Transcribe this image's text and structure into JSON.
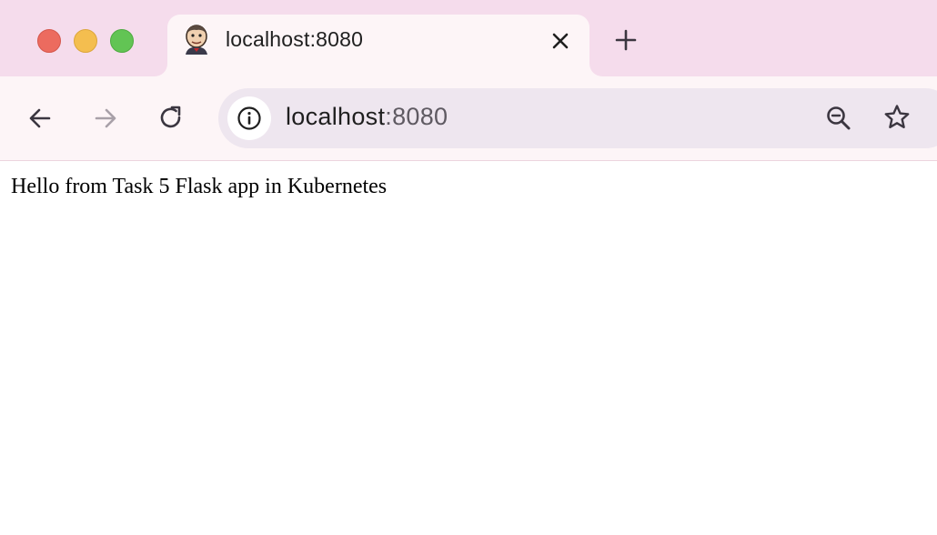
{
  "window": {
    "traffic_lights": [
      "close",
      "minimize",
      "maximize"
    ]
  },
  "tab": {
    "title": "localhost:8080",
    "favicon": "jenkins-butler-icon"
  },
  "toolbar": {
    "url_host": "localhost",
    "url_port": ":8080",
    "icons": [
      "back-arrow-icon",
      "forward-arrow-icon",
      "reload-icon",
      "site-info-icon",
      "zoom-out-icon",
      "bookmark-star-icon"
    ]
  },
  "page": {
    "text": "Hello from Task 5 Flask app in Kubernetes"
  },
  "colors": {
    "titlebar": "#f5dcec",
    "toolbar": "#fdf5f7",
    "omnibox": "#eee6ef"
  }
}
